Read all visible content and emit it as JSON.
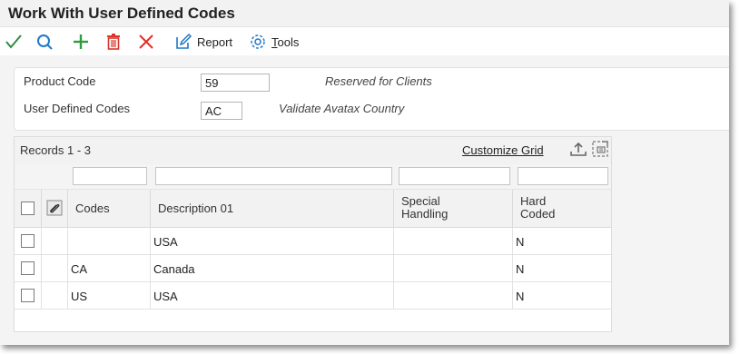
{
  "window": {
    "title": "Work With User Defined Codes"
  },
  "toolbar": {
    "select_icon": "checkmark-icon",
    "find_icon": "search-icon",
    "add_icon": "plus-icon",
    "delete_icon": "trash-icon",
    "close_icon": "close-x-icon",
    "report_label": "Report",
    "tools_label_hotkey": "T",
    "tools_label_rest": "ools"
  },
  "header": {
    "product_code_label": "Product Code",
    "product_code_value": "59",
    "product_code_desc": "Reserved for Clients",
    "udc_label": "User Defined Codes",
    "udc_value": "AC",
    "udc_desc": "Validate Avatax Country"
  },
  "grid": {
    "records_label": "Records 1 - 3",
    "customize_label": "Customize Grid",
    "columns": {
      "codes": "Codes",
      "description": "Description 01",
      "special_line1": "Special",
      "special_line2": "Handling",
      "hard_line1": "Hard",
      "hard_line2": "Coded"
    },
    "rows": [
      {
        "code": "",
        "description": "USA",
        "special": "",
        "hard_coded": "N"
      },
      {
        "code": "CA",
        "description": "Canada",
        "special": "",
        "hard_coded": "N"
      },
      {
        "code": "US",
        "description": "USA",
        "special": "",
        "hard_coded": "N"
      }
    ]
  },
  "colors": {
    "select_green": "#2e8b3d",
    "find_blue": "#1f78c8",
    "add_green": "#2e9b3f",
    "delete_red": "#d9362b",
    "close_red": "#e0302a"
  }
}
